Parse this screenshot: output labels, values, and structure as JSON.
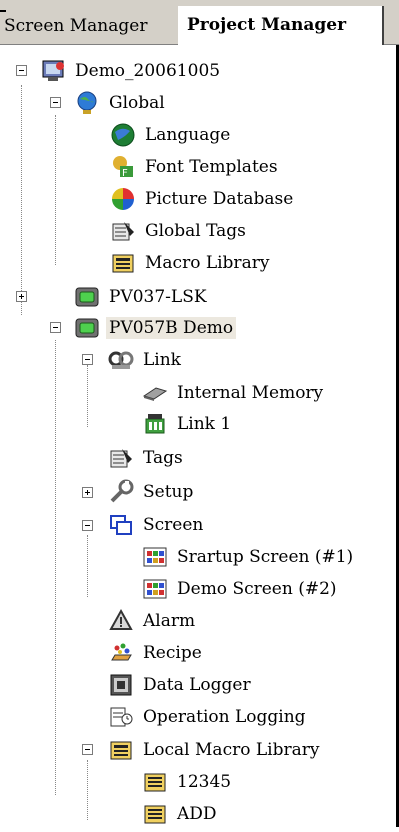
{
  "tabs": {
    "screen_manager": "Screen Manager",
    "project_manager": "Project Manager"
  },
  "tree": {
    "project": "Demo_20061005",
    "global": {
      "label": "Global",
      "items": [
        "Language",
        "Font Templates",
        "Picture Database",
        "Global Tags",
        "Macro Library"
      ]
    },
    "pv037": "PV037-LSK",
    "pv057": {
      "label": "PV057B Demo",
      "link": {
        "label": "Link",
        "items": [
          "Internal Memory",
          "Link 1"
        ]
      },
      "tags": "Tags",
      "setup": "Setup",
      "screen": {
        "label": "Screen",
        "items": [
          "Srartup Screen (#1)",
          "Demo Screen (#2)"
        ]
      },
      "alarm": "Alarm",
      "recipe": "Recipe",
      "data_logger": "Data Logger",
      "operation_logging": "Operation Logging",
      "local_macro": {
        "label": "Local Macro Library",
        "items": [
          "12345",
          "ADD"
        ]
      }
    }
  },
  "colors": {
    "tab_bar": "#d4d0c8",
    "selection": "#ece8df",
    "panel_border": "#000000"
  }
}
